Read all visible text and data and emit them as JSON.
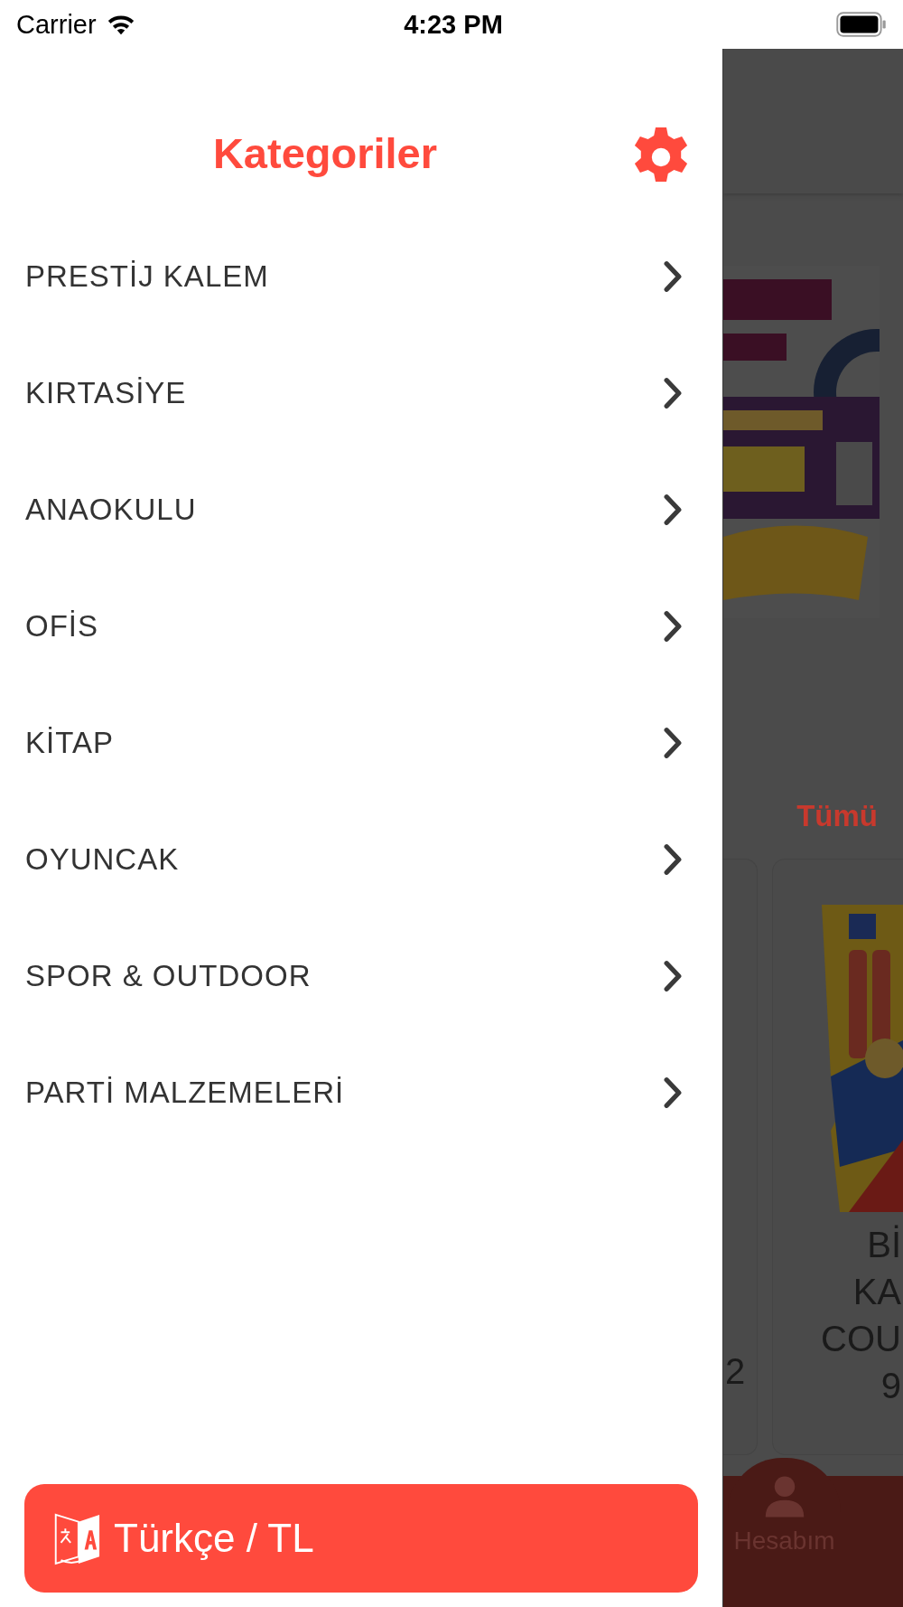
{
  "status_bar": {
    "carrier": "Carrier",
    "time": "4:23 PM"
  },
  "drawer": {
    "title": "Kategoriler",
    "items": [
      {
        "label": "PRESTİJ KALEM"
      },
      {
        "label": "KIRTASİYE"
      },
      {
        "label": "ANAOKULU"
      },
      {
        "label": "OFİS"
      },
      {
        "label": "KİTAP"
      },
      {
        "label": "OYUNCAK"
      },
      {
        "label": "SPOR & OUTDOOR"
      },
      {
        "label": "PARTİ MALZEMELERİ"
      }
    ],
    "language_button": {
      "label": "Türkçe / TL"
    }
  },
  "background_page": {
    "see_all_link": "Tümü",
    "products": [
      {
        "title_lines": [
          "2"
        ]
      },
      {
        "kind": "picture",
        "title_lines": [
          "Bİ",
          "KA",
          "COU",
          "9"
        ]
      }
    ],
    "tab_bar": {
      "label": "Hesabım"
    }
  }
}
